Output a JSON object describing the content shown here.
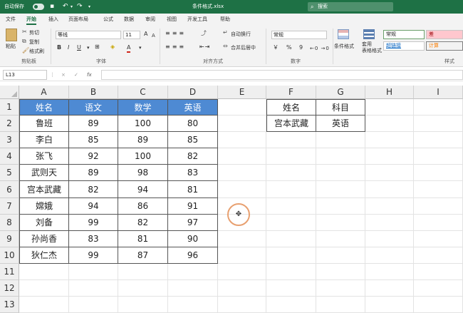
{
  "titlebar": {
    "autosave_label": "自动保存",
    "autosave_state": "关",
    "save_icon": "save-icon",
    "undo_icon": "undo-icon",
    "redo_icon": "redo-icon",
    "filename": "条件格式.xlsx",
    "search_placeholder": "搜索",
    "bg_color": "#1e7145"
  },
  "tabs": [
    "文件",
    "开始",
    "插入",
    "页面布局",
    "公式",
    "数据",
    "审阅",
    "视图",
    "开发工具",
    "帮助"
  ],
  "active_tab": "开始",
  "ribbon": {
    "clipboard": {
      "paste": "粘贴",
      "cut": "剪切",
      "copy": "复制",
      "format_painter": "格式刷",
      "group": "剪贴板"
    },
    "font": {
      "name": "等线",
      "size": "11",
      "group": "字体",
      "bold": "B",
      "italic": "I",
      "underline": "U",
      "grow": "A",
      "shrink": "A",
      "color_a": "A"
    },
    "alignment": {
      "wrap": "自动换行",
      "merge": "合并后居中",
      "group": "对齐方式"
    },
    "number": {
      "format": "常规",
      "currency": "￥",
      "percent": "%",
      "comma": "9",
      "group": "数字"
    },
    "styles": {
      "conditional": "条件格式",
      "table": "套用\n表格格式",
      "normal": "常规",
      "bad": "差",
      "hyperlink": "超链接",
      "calc": "计算",
      "group": "样式"
    }
  },
  "formula_bar": {
    "name_box": "L13",
    "cancel": "×",
    "enter": "✓",
    "fx": "fx",
    "value": ""
  },
  "sheet": {
    "columns": [
      "A",
      "B",
      "C",
      "D",
      "E",
      "F",
      "G",
      "H",
      "I"
    ],
    "rows": [
      "1",
      "2",
      "3",
      "4",
      "5",
      "6",
      "7",
      "8",
      "9",
      "10",
      "11",
      "12",
      "13"
    ],
    "main_table": {
      "header": [
        "姓名",
        "语文",
        "数学",
        "英语"
      ],
      "data": [
        [
          "鲁班",
          "89",
          "100",
          "80"
        ],
        [
          "李白",
          "85",
          "89",
          "85"
        ],
        [
          "张飞",
          "92",
          "100",
          "82"
        ],
        [
          "武则天",
          "89",
          "98",
          "83"
        ],
        [
          "宫本武藏",
          "82",
          "94",
          "81"
        ],
        [
          "嫦娥",
          "94",
          "86",
          "91"
        ],
        [
          "刘备",
          "99",
          "82",
          "97"
        ],
        [
          "孙尚香",
          "83",
          "81",
          "90"
        ],
        [
          "狄仁杰",
          "99",
          "87",
          "96"
        ]
      ]
    },
    "lookup_table": {
      "header": [
        "姓名",
        "科目"
      ],
      "data": [
        [
          "宫本武藏",
          "英语"
        ]
      ]
    },
    "header_fill": "#4e8ad3"
  }
}
